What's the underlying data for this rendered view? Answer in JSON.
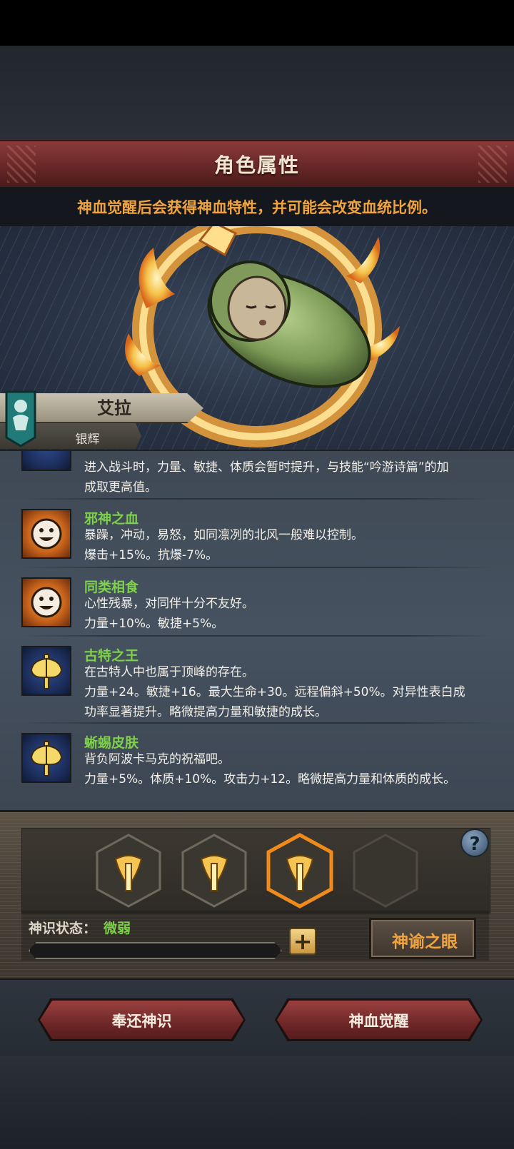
{
  "header": {
    "title": "角色属性"
  },
  "hint": "神血觉醒后会获得神血特性，并可能会改变血统比例。",
  "character": {
    "name": "艾拉",
    "subtitle": "银辉"
  },
  "traits": {
    "partial": {
      "lines": [
        "进入战斗时，力量、敏捷、体质会暂时提升，与技能“吟游诗篇”的加",
        "成取更高值。"
      ],
      "icon": "axe-icon"
    },
    "items": [
      {
        "name": "邪神之血",
        "icon": "smiley-sun-icon",
        "lines": [
          "暴躁，冲动，易怒，如同凛冽的北风一般难以控制。",
          "爆击+15%。抗爆-7%。"
        ]
      },
      {
        "name": "同类相食",
        "icon": "smiley-sun-icon",
        "lines": [
          "心性残暴，对同伴十分不友好。",
          "力量+10%。敏捷+5%。"
        ]
      },
      {
        "name": "古特之王",
        "icon": "axe-icon",
        "lines": [
          "在古特人中也属于顶峰的存在。",
          "力量+24。敏捷+16。最大生命+30。远程偏斜+50%。对异性表白成",
          "功率显著提升。略微提高力量和敏捷的成长。"
        ]
      },
      {
        "name": "蜥蜴皮肤",
        "icon": "axe-icon",
        "lines": [
          "背负阿波卡马克的祝福吧。",
          "力量+5%。体质+10%。攻击力+12。略微提高力量和体质的成长。"
        ]
      }
    ]
  },
  "divine_sense": {
    "help_label": "?",
    "status_label": "神识状态：",
    "status_value": "微弱",
    "progress": 0.0,
    "plus_label": "+",
    "oracle_label": "神谕之眼",
    "sockets": [
      {
        "state": "filled",
        "icon": "trident-icon"
      },
      {
        "state": "filled",
        "icon": "trident-icon"
      },
      {
        "state": "selected",
        "icon": "trident-icon"
      },
      {
        "state": "empty"
      }
    ]
  },
  "actions": {
    "return_label": "奉还神识",
    "awaken_label": "神血觉醒"
  },
  "colors": {
    "accent_orange": "#f0a440",
    "trait_green": "#7ed14a",
    "banner_red": "#6e2727"
  }
}
